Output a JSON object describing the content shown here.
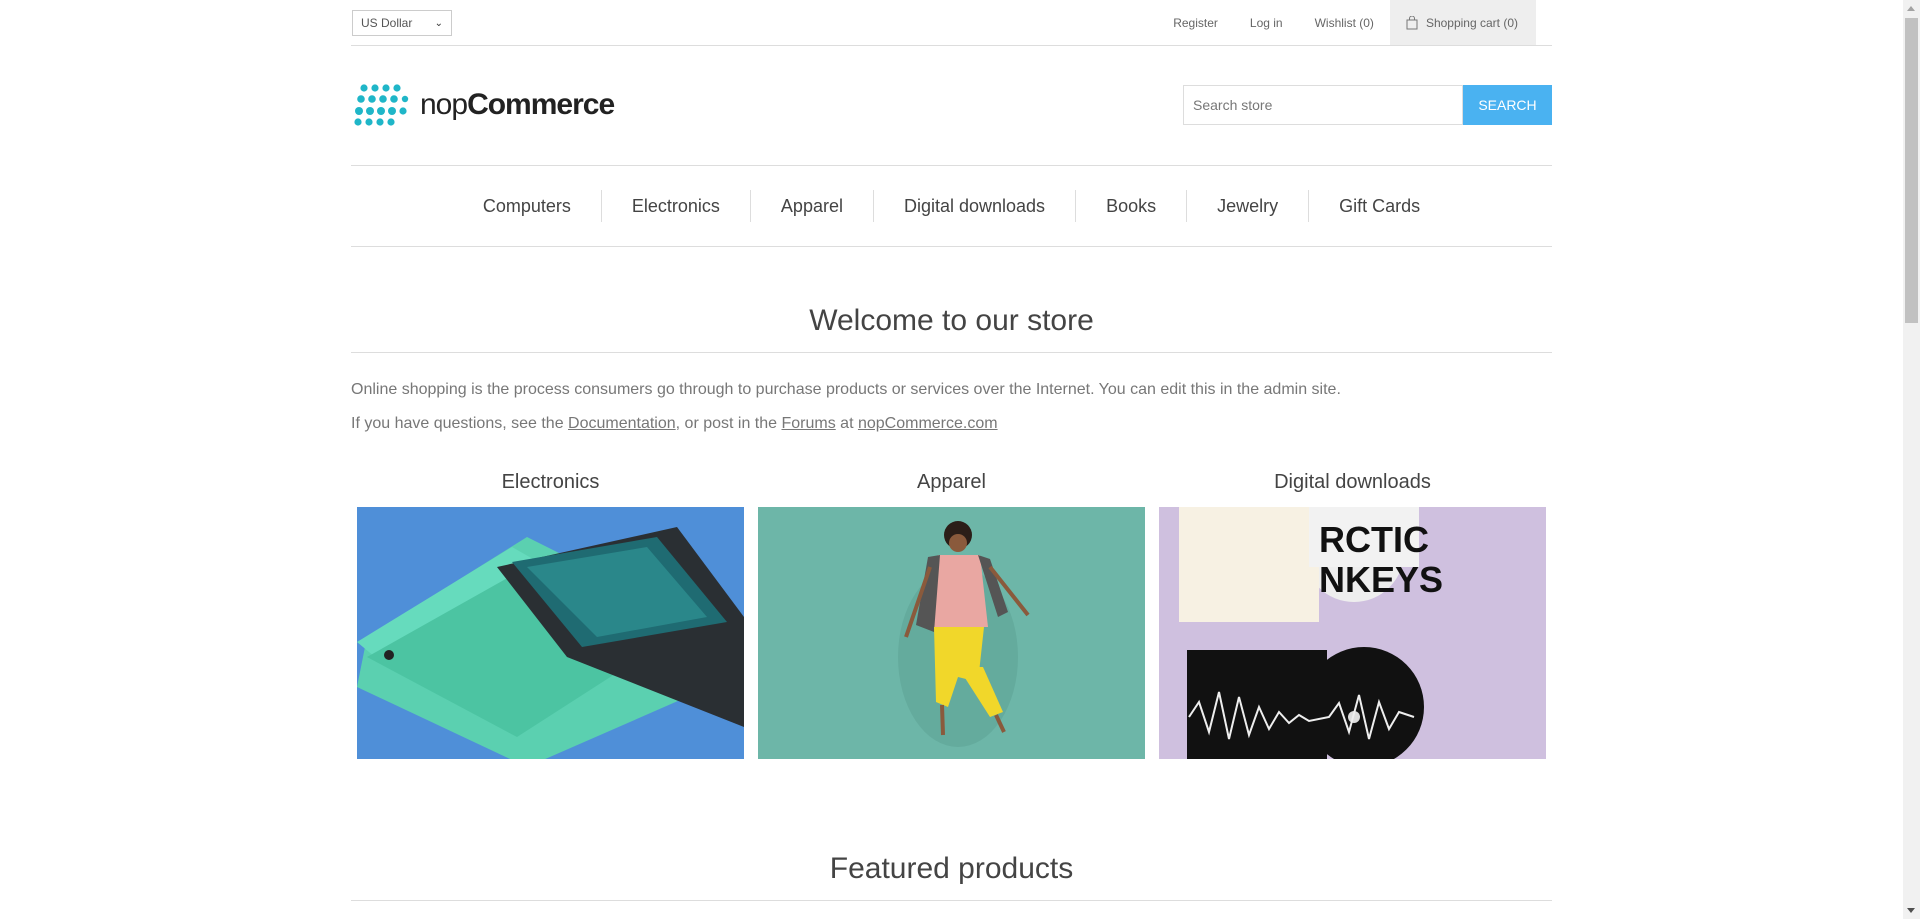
{
  "header": {
    "currency": "US Dollar",
    "links": {
      "register": "Register",
      "login": "Log in",
      "wishlist": "Wishlist (0)",
      "cart": "Shopping cart (0)"
    }
  },
  "logo": {
    "part1": "nop",
    "part2": "Commerce"
  },
  "search": {
    "placeholder": "Search store",
    "button": "SEARCH"
  },
  "menu": [
    "Computers",
    "Electronics",
    "Apparel",
    "Digital downloads",
    "Books",
    "Jewelry",
    "Gift Cards"
  ],
  "welcome": {
    "title": "Welcome to our store",
    "line1": "Online shopping is the process consumers go through to purchase products or services over the Internet. You can edit this in the admin site.",
    "line2_prefix": "If you have questions, see the ",
    "documentation": "Documentation",
    "line2_mid": ", or post in the ",
    "forums": "Forums",
    "line2_at": " at ",
    "site": "nopCommerce.com"
  },
  "categories": [
    {
      "title": "Electronics"
    },
    {
      "title": "Apparel"
    },
    {
      "title": "Digital downloads"
    }
  ],
  "featured_title": "Featured products",
  "colors": {
    "accent": "#4ab2f1",
    "logo": "#1fb6c8"
  }
}
